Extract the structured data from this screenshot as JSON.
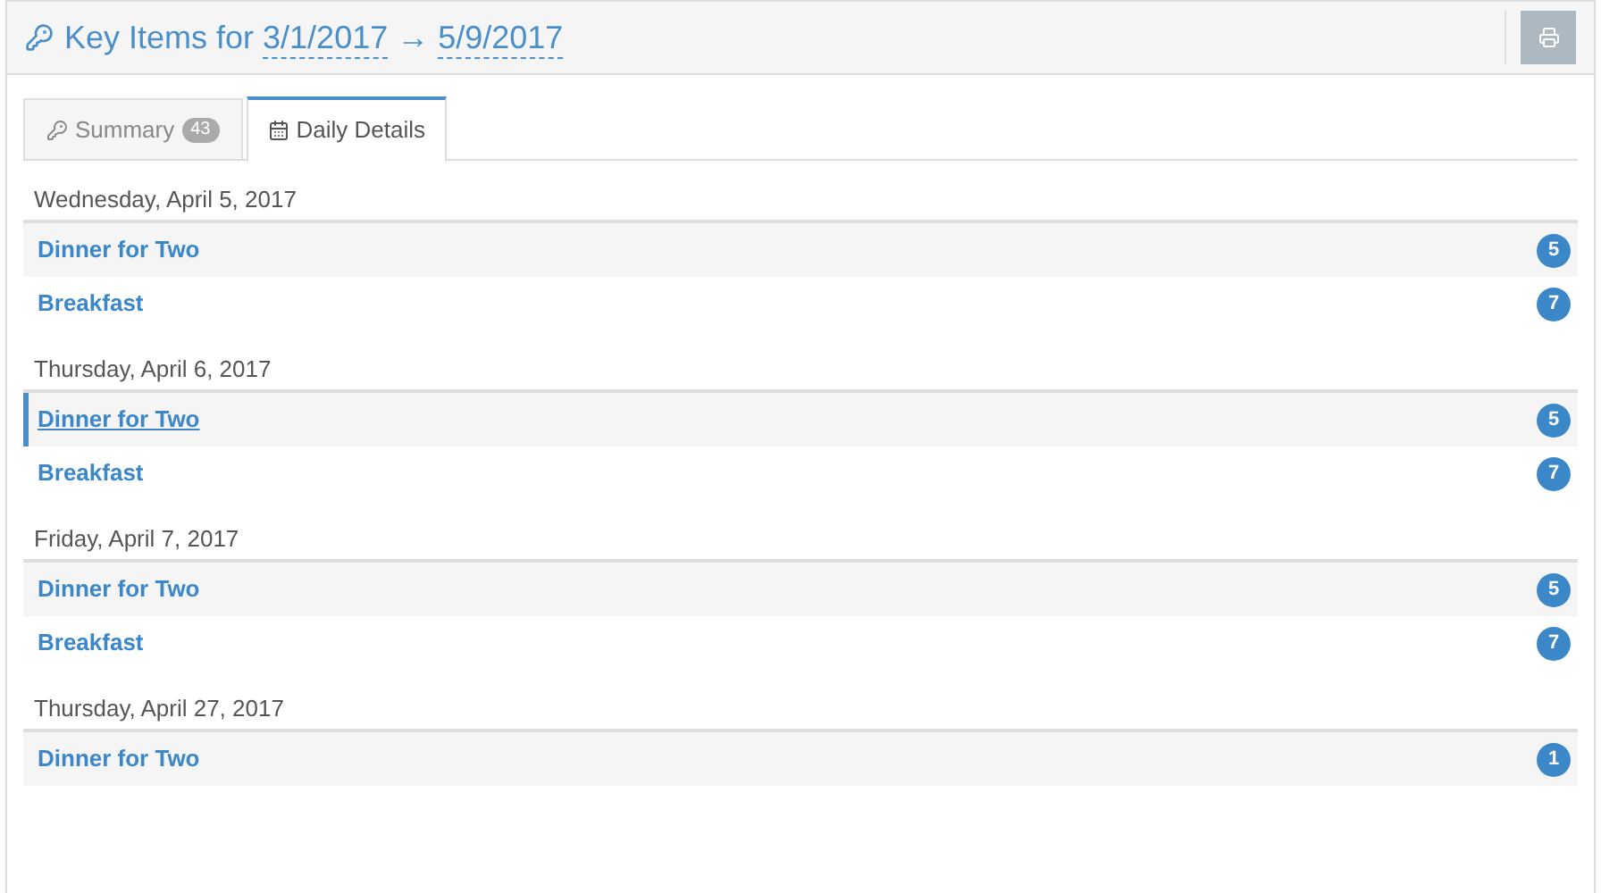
{
  "header": {
    "title": "Key Items for",
    "start_date": "3/1/2017",
    "arrow": "→",
    "end_date": "5/9/2017"
  },
  "tabs": [
    {
      "label": "Summary",
      "count": "43",
      "kind": "key",
      "selected": false
    },
    {
      "label": "Daily Details",
      "kind": "calendar",
      "selected": true
    }
  ],
  "days": [
    {
      "date": "Wednesday, April 5, 2017",
      "items": [
        {
          "name": "Dinner for Two",
          "count": "5",
          "highlighted": false
        },
        {
          "name": "Breakfast",
          "count": "7",
          "highlighted": false
        }
      ]
    },
    {
      "date": "Thursday, April 6, 2017",
      "items": [
        {
          "name": "Dinner for Two",
          "count": "5",
          "highlighted": true
        },
        {
          "name": "Breakfast",
          "count": "7",
          "highlighted": false
        }
      ]
    },
    {
      "date": "Friday, April 7, 2017",
      "items": [
        {
          "name": "Dinner for Two",
          "count": "5",
          "highlighted": false
        },
        {
          "name": "Breakfast",
          "count": "7",
          "highlighted": false
        }
      ]
    },
    {
      "date": "Thursday, April 27, 2017",
      "items": [
        {
          "name": "Dinner for Two",
          "count": "1",
          "highlighted": false
        }
      ]
    }
  ]
}
